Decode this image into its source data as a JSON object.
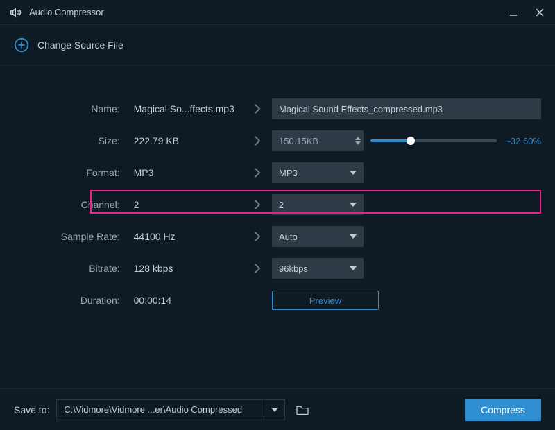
{
  "app": {
    "title": "Audio Compressor"
  },
  "source_bar": {
    "change_label": "Change Source File"
  },
  "labels": {
    "name": "Name:",
    "size": "Size:",
    "format": "Format:",
    "channel": "Channel:",
    "sample_rate": "Sample Rate:",
    "bitrate": "Bitrate:",
    "duration": "Duration:"
  },
  "source": {
    "name": "Magical So...ffects.mp3",
    "size": "222.79 KB",
    "format": "MP3",
    "channel": "2",
    "sample_rate": "44100 Hz",
    "bitrate": "128 kbps",
    "duration": "00:00:14"
  },
  "target": {
    "name": "Magical Sound Effects_compressed.mp3",
    "size": "150.15KB",
    "size_percent": "-32.60%",
    "slider_fill_pct": 32,
    "format": "MP3",
    "channel": "2",
    "sample_rate": "Auto",
    "bitrate": "96kbps"
  },
  "buttons": {
    "preview": "Preview",
    "compress": "Compress"
  },
  "footer": {
    "save_to_label": "Save to:",
    "save_path": "C:\\Vidmore\\Vidmore ...er\\Audio Compressed"
  }
}
